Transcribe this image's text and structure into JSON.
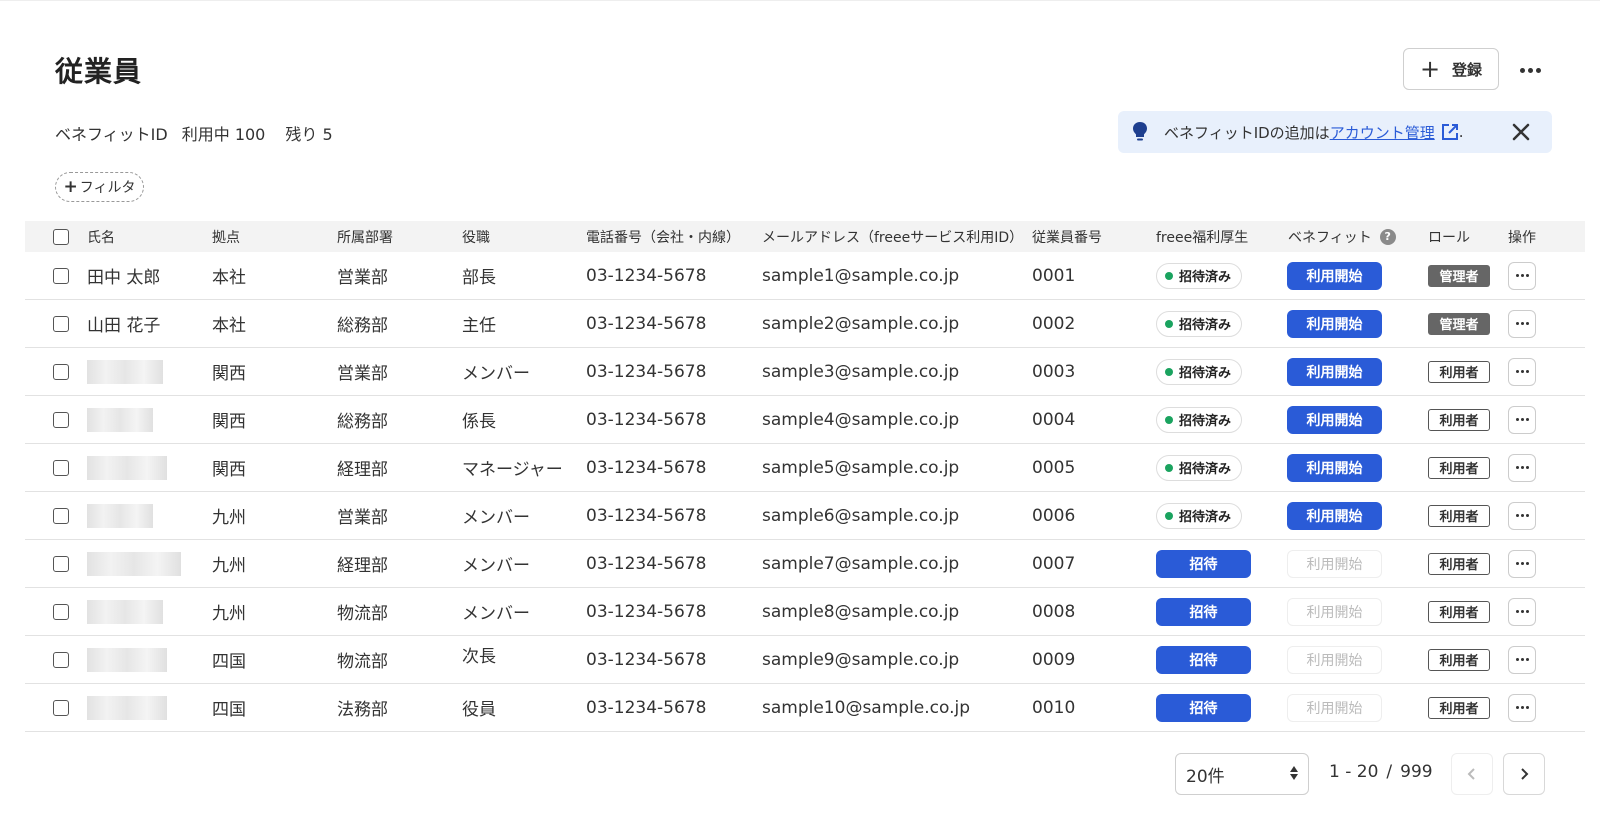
{
  "header": {
    "title": "従業員",
    "register_label": "登録"
  },
  "benefit": {
    "label": "ベネフィットID",
    "in_use": "利用中 100",
    "remaining": "残り 5"
  },
  "notice": {
    "text_before": "ベネフィットIDの追加は",
    "link": "アカウント管理",
    "text_after": "."
  },
  "filter": {
    "label": "フィルタ"
  },
  "columns": {
    "name": "氏名",
    "location": "拠点",
    "department": "所属部署",
    "position": "役職",
    "phone": "電話番号（会社・内線）",
    "email": "メールアドレス（freeeサービス利用ID）",
    "emp_no": "従業員番号",
    "welfare": "freee福利厚生",
    "benefit": "ベネフィット",
    "role": "ロール",
    "actions": "操作"
  },
  "rows": [
    {
      "name": "田中 太郎",
      "location": "本社",
      "department": "営業部",
      "position": "部長",
      "phone": "03-1234-5678",
      "email": "sample1@sample.co.jp",
      "emp_no": "0001",
      "welfare": "招待済み",
      "benefit": "利用開始",
      "role": "管理者"
    },
    {
      "name": "山田 花子",
      "location": "本社",
      "department": "総務部",
      "position": "主任",
      "phone": "03-1234-5678",
      "email": "sample2@sample.co.jp",
      "emp_no": "0002",
      "welfare": "招待済み",
      "benefit": "利用開始",
      "role": "管理者"
    },
    {
      "name": "",
      "location": "関西",
      "department": "営業部",
      "position": "メンバー",
      "phone": "03-1234-5678",
      "email": "sample3@sample.co.jp",
      "emp_no": "0003",
      "welfare": "招待済み",
      "benefit": "利用開始",
      "role": "利用者"
    },
    {
      "name": "",
      "location": "関西",
      "department": "総務部",
      "position": "係長",
      "phone": "03-1234-5678",
      "email": "sample4@sample.co.jp",
      "emp_no": "0004",
      "welfare": "招待済み",
      "benefit": "利用開始",
      "role": "利用者"
    },
    {
      "name": "",
      "location": "関西",
      "department": "経理部",
      "position": "マネージャー",
      "phone": "03-1234-5678",
      "email": "sample5@sample.co.jp",
      "emp_no": "0005",
      "welfare": "招待済み",
      "benefit": "利用開始",
      "role": "利用者"
    },
    {
      "name": "",
      "location": "九州",
      "department": "営業部",
      "position": "メンバー",
      "phone": "03-1234-5678",
      "email": "sample6@sample.co.jp",
      "emp_no": "0006",
      "welfare": "招待済み",
      "benefit": "利用開始",
      "role": "利用者"
    },
    {
      "name": "",
      "location": "九州",
      "department": "経理部",
      "position": "メンバー",
      "phone": "03-1234-5678",
      "email": "sample7@sample.co.jp",
      "emp_no": "0007",
      "welfare": "招待",
      "benefit": "利用開始",
      "role": "利用者"
    },
    {
      "name": "",
      "location": "九州",
      "department": "物流部",
      "position": "メンバー",
      "phone": "03-1234-5678",
      "email": "sample8@sample.co.jp",
      "emp_no": "0008",
      "welfare": "招待",
      "benefit": "利用開始",
      "role": "利用者"
    },
    {
      "name": "",
      "location": "四国",
      "department": "物流部",
      "position": "次長",
      "phone": "03-1234-5678",
      "email": "sample9@sample.co.jp",
      "emp_no": "0009",
      "welfare": "招待",
      "benefit": "利用開始",
      "role": "利用者"
    },
    {
      "name": "",
      "location": "四国",
      "department": "法務部",
      "position": "役員",
      "phone": "03-1234-5678",
      "email": "sample10@sample.co.jp",
      "emp_no": "0010",
      "welfare": "招待",
      "benefit": "利用開始",
      "role": "利用者"
    }
  ],
  "pagination": {
    "per_page": "20件",
    "range": "1 - 20",
    "separator": "/",
    "total": "999"
  },
  "colors": {
    "accent": "#2a5bd7",
    "invited_dot": "#1aa35f",
    "admin_badge": "#666666"
  }
}
